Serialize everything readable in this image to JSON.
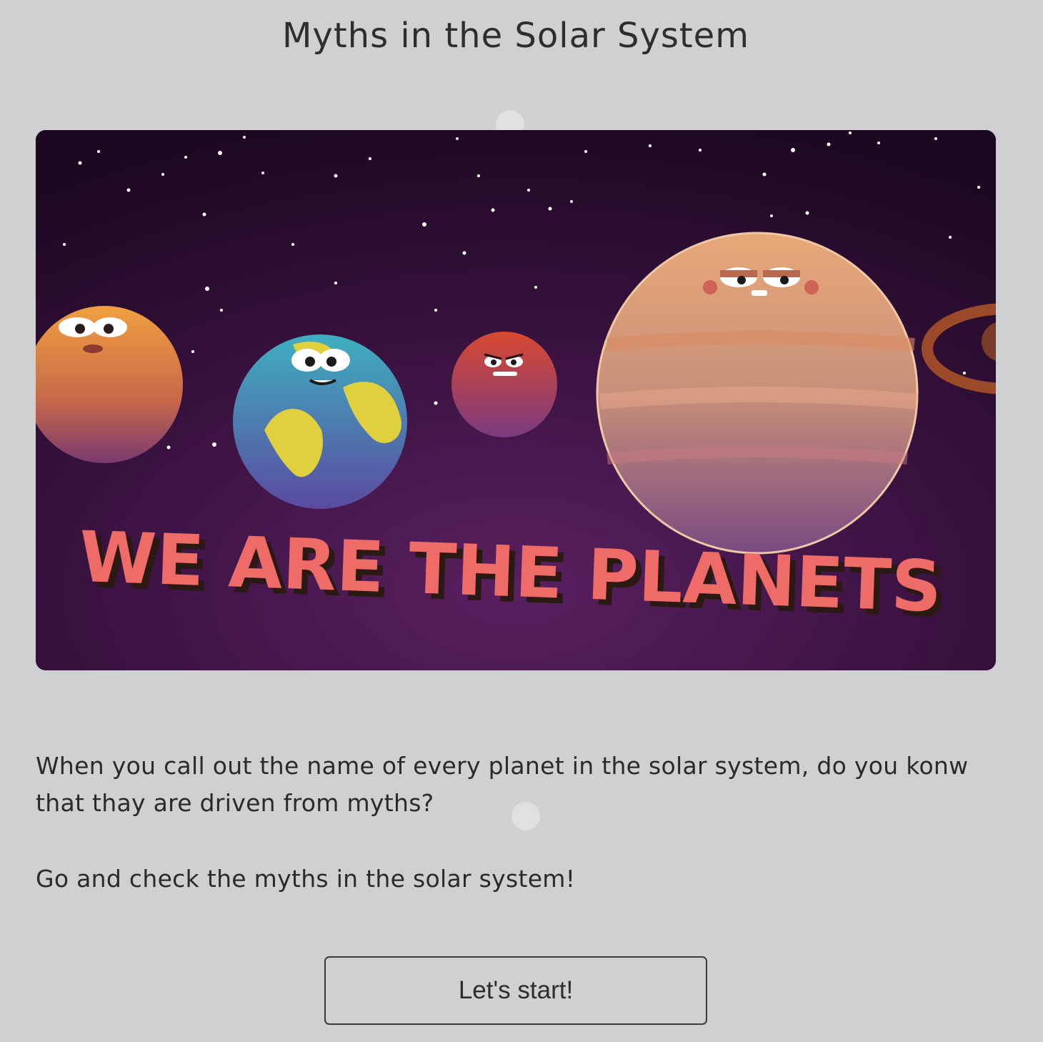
{
  "page": {
    "title": "Myths in the Solar System"
  },
  "hero": {
    "banner_text": "WE ARE THE PLANETS",
    "colors": {
      "space": "#2a0c2c",
      "banner_text": "#ee6b68",
      "banner_shadow": "#2b1a14"
    }
  },
  "content": {
    "intro": "When you call out the name of every planet in the solar system, do you konw that thay are driven from myths?",
    "cta_line": "Go and check the myths in the solar system!"
  },
  "actions": {
    "start_label": "Let's start!"
  },
  "colors": {
    "background": "#cfd0d2",
    "text": "#2d2d2d"
  }
}
